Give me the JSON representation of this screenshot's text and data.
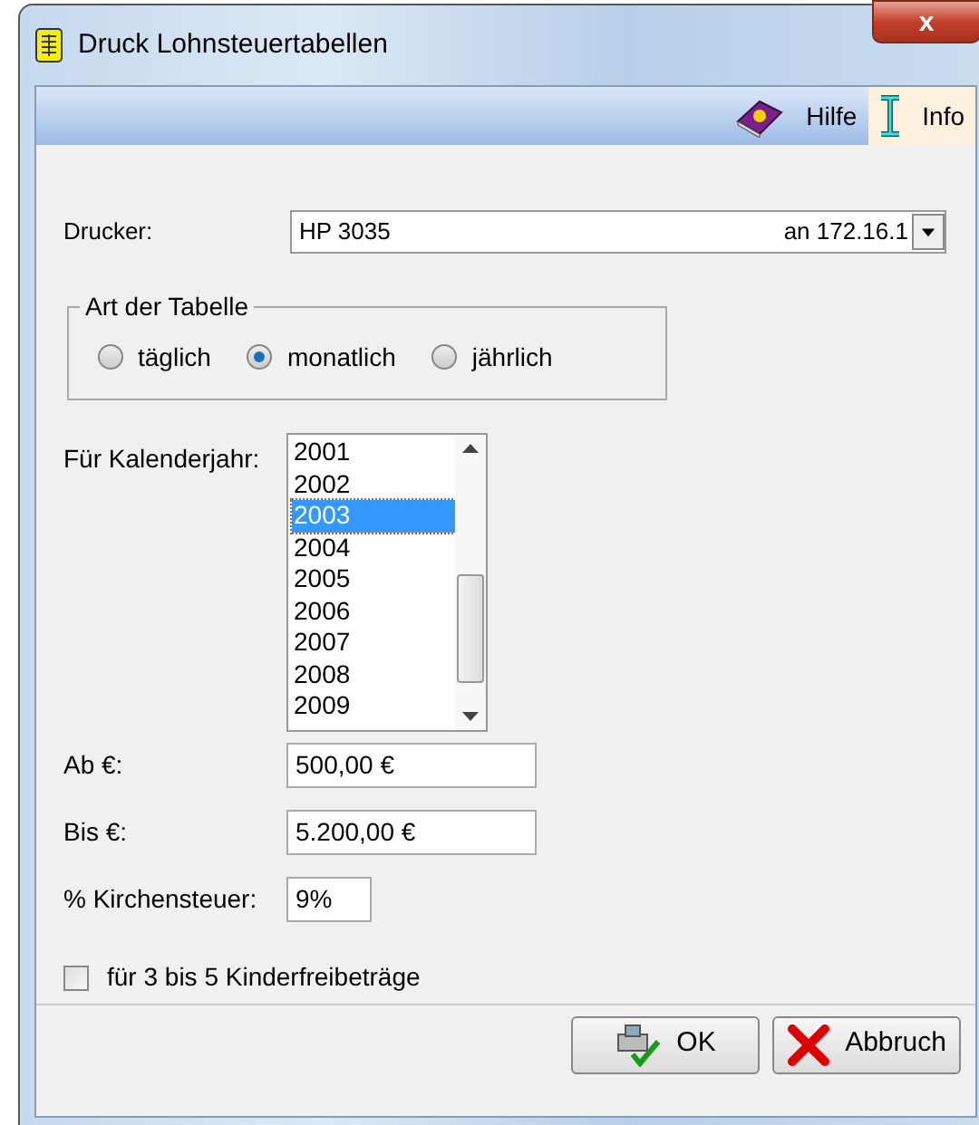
{
  "window": {
    "title": "Druck Lohnsteuertabellen",
    "close": "x"
  },
  "toolbar": [
    {
      "label": "Hilfe",
      "kind": "help",
      "selected": false
    },
    {
      "label": "Info",
      "kind": "info",
      "selected": true
    }
  ],
  "printer": {
    "label": "Drucker:",
    "name": "HP 3035",
    "port": "an 172.16.1"
  },
  "table_type": {
    "legend": "Art der Tabelle",
    "options": [
      {
        "label": "täglich",
        "selected": false
      },
      {
        "label": "monatlich",
        "selected": true
      },
      {
        "label": "jährlich",
        "selected": false
      }
    ]
  },
  "year": {
    "label": "Für Kalenderjahr:",
    "items": [
      {
        "label": "2001",
        "selected": false
      },
      {
        "label": "2002",
        "selected": false
      },
      {
        "label": "2003",
        "selected": true
      },
      {
        "label": "2004",
        "selected": false
      },
      {
        "label": "2005",
        "selected": false
      },
      {
        "label": "2006",
        "selected": false
      },
      {
        "label": "2007",
        "selected": false
      },
      {
        "label": "2008",
        "selected": false
      },
      {
        "label": "2009",
        "selected": false
      }
    ]
  },
  "fields": [
    {
      "label": "Ab €:",
      "value": "500,00 €",
      "kind": "wide"
    },
    {
      "label": "Bis €:",
      "value": "5.200,00 €",
      "kind": "wide"
    },
    {
      "label": "% Kirchensteuer:",
      "value": "9%",
      "kind": "narrow"
    }
  ],
  "child_allowance": {
    "label": "für 3 bis 5 Kinderfreibeträge",
    "checked": false
  },
  "buttons": [
    {
      "label": "OK",
      "kind": "ok"
    },
    {
      "label": "Abbruch",
      "kind": "cancel"
    }
  ]
}
